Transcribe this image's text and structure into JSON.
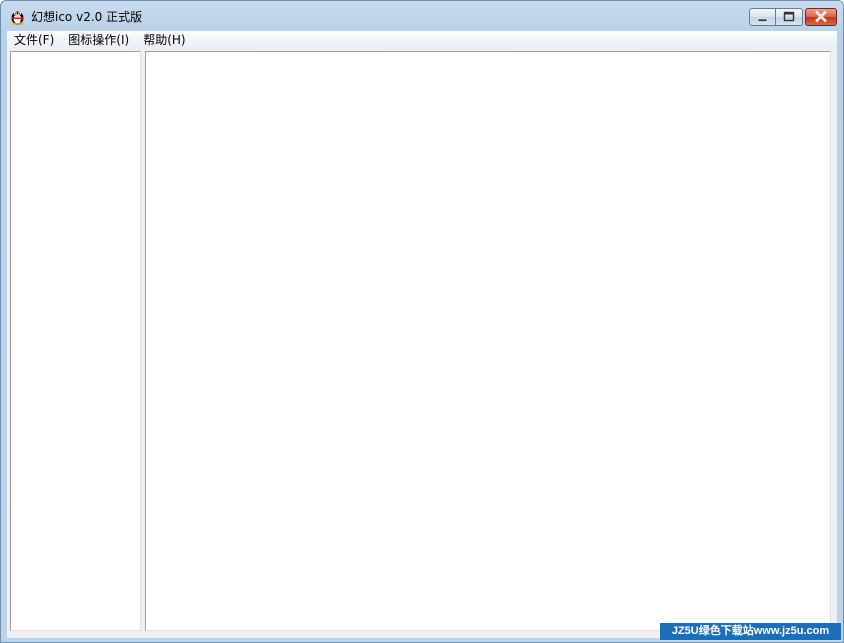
{
  "window": {
    "title": "幻想ico v2.0 正式版",
    "icon": "qq-penguin-icon",
    "controls": {
      "minimize": "minimize-icon",
      "maximize": "maximize-icon",
      "close": "close-icon"
    }
  },
  "menubar": {
    "items": [
      {
        "label": "文件(F)"
      },
      {
        "label": "图标操作(I)"
      },
      {
        "label": "帮助(H)"
      }
    ]
  },
  "watermark": {
    "text": "JZ5U绿色下载站www.jz5u.com"
  },
  "colors": {
    "title_bar": "#bcd3ec",
    "close_button": "#c1361d",
    "watermark_bg": "#1c6fb6"
  }
}
